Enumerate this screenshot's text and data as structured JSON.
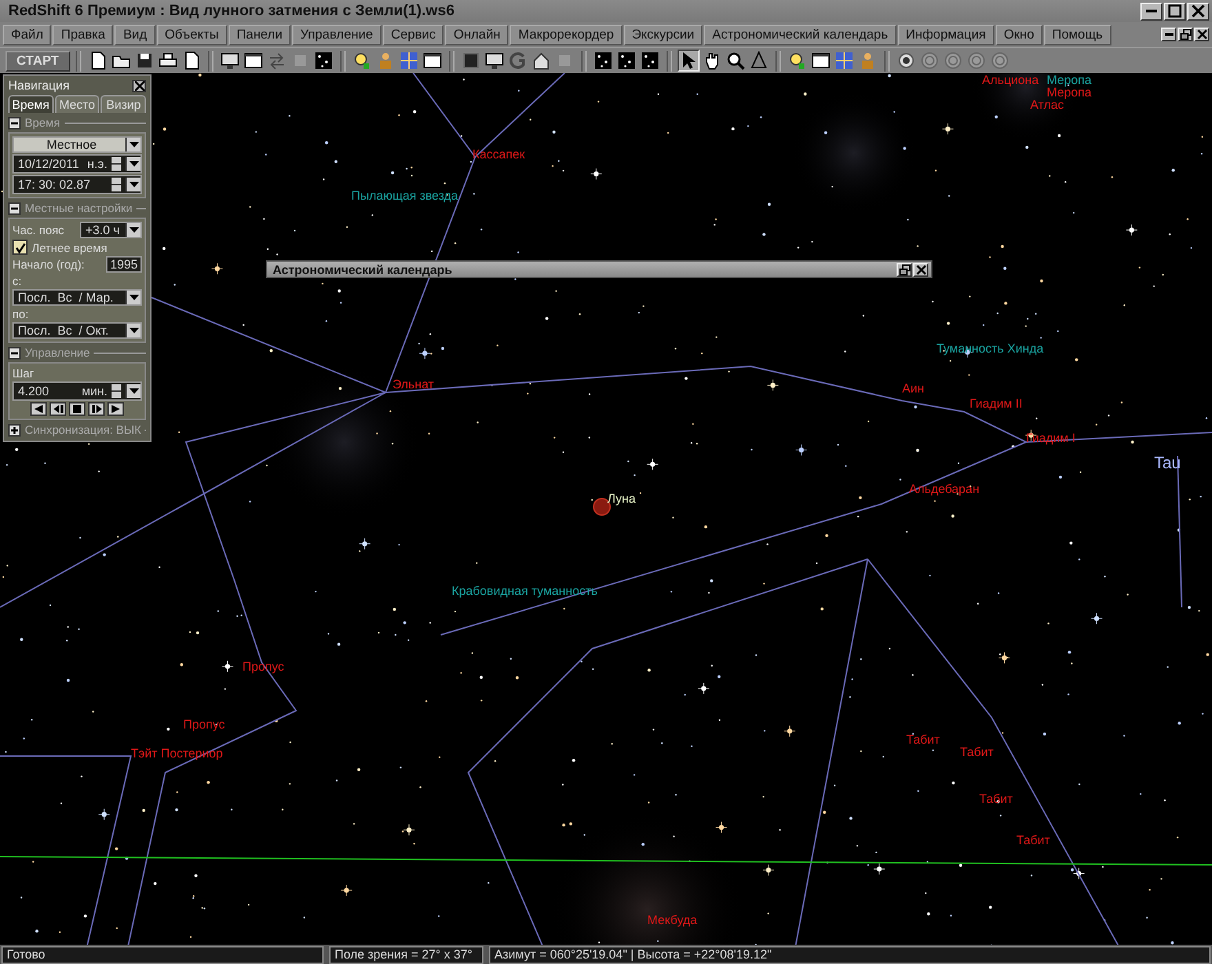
{
  "window": {
    "title": "RedShift 6 Премиум : Вид лунного затмения с Земли(1).ws6"
  },
  "menu": [
    "Файл",
    "Правка",
    "Вид",
    "Объекты",
    "Панели",
    "Управление",
    "Сервис",
    "Онлайн",
    "Макрорекордер",
    "Экскурсии",
    "Астрономический календарь",
    "Информация",
    "Окно",
    "Помощь"
  ],
  "toolbar": {
    "start_button": "СТАРТ"
  },
  "navigation": {
    "title": "Навигация",
    "tabs": [
      {
        "label": "Время",
        "selected": true
      },
      {
        "label": "Место",
        "selected": false
      },
      {
        "label": "Визир",
        "selected": false
      }
    ],
    "time_section": {
      "title": "Время",
      "expanded": true,
      "mode": "Местное",
      "date": "10/12/2011",
      "era": "н.э.",
      "time": "17: 30: 02.87"
    },
    "local_settings": {
      "title": "Местные настройки",
      "expanded": true,
      "timezone_label": "Час. пояс",
      "timezone": "+3.0 ч",
      "dst": {
        "label": "Летнее время",
        "checked": true
      },
      "start_year_label": "Начало (год):",
      "start_year": "1995",
      "from_label": "с:",
      "from": "Посл.  Вс  / Мар.",
      "to_label": "по:",
      "to": "Посл.  Вс  / Окт."
    },
    "control": {
      "title": "Управление",
      "expanded": true,
      "step_label": "Шаг",
      "step": "4.200",
      "step_unit": "мин."
    },
    "sync": {
      "title": "Синхронизация: ВЫК",
      "expanded": false
    }
  },
  "calendar_window": {
    "title": "Астрономический календарь"
  },
  "sky_labels": [
    {
      "text": "Альциона",
      "kind": "star"
    },
    {
      "text": "Меропа",
      "kind": "nebula"
    },
    {
      "text": "Меропа",
      "kind": "star"
    },
    {
      "text": "Атлас",
      "kind": "star"
    },
    {
      "text": "Кассапек",
      "kind": "star"
    },
    {
      "text": "Пылающая звезда",
      "kind": "nebula"
    },
    {
      "text": "Туманность Хинда",
      "kind": "nebula"
    },
    {
      "text": "Эльнат",
      "kind": "star"
    },
    {
      "text": "Аин",
      "kind": "star"
    },
    {
      "text": "Гиадим II",
      "kind": "star"
    },
    {
      "text": "Гиадим I",
      "kind": "star"
    },
    {
      "text": "Tau",
      "kind": "constellation"
    },
    {
      "text": "Альдебаран",
      "kind": "star"
    },
    {
      "text": "Луна",
      "kind": "moon"
    },
    {
      "text": "Крабовидная туманность",
      "kind": "nebula"
    },
    {
      "text": "Пропус",
      "kind": "star"
    },
    {
      "text": "Пропус",
      "kind": "star"
    },
    {
      "text": "Тэйт Постериор",
      "kind": "star"
    },
    {
      "text": "Табит",
      "kind": "star"
    },
    {
      "text": "Табит",
      "kind": "star"
    },
    {
      "text": "Табит",
      "kind": "star"
    },
    {
      "text": "Табит",
      "kind": "star"
    },
    {
      "text": "Мекбуда",
      "kind": "star"
    }
  ],
  "status_bar": [
    "Готово",
    "Поле зрения = 27° x 37°",
    "Азимут = 060°25'19.04\" | Высота = +22°08'19.12\""
  ]
}
